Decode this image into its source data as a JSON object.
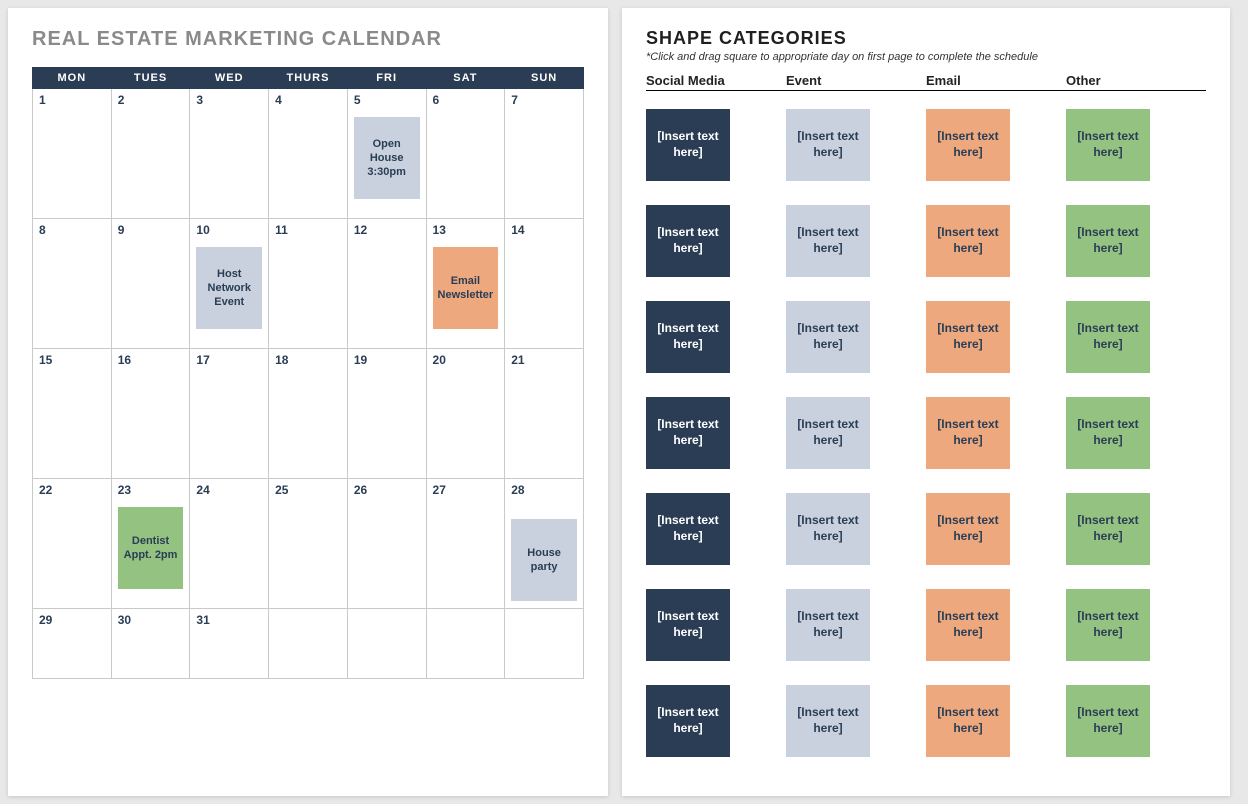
{
  "left": {
    "title": "REAL ESTATE MARKETING CALENDAR",
    "weekdays": [
      "MON",
      "TUES",
      "WED",
      "THURS",
      "FRI",
      "SAT",
      "SUN"
    ],
    "weeks": [
      [
        {
          "n": "1"
        },
        {
          "n": "2"
        },
        {
          "n": "3"
        },
        {
          "n": "4"
        },
        {
          "n": "5",
          "event": "Open House 3:30pm",
          "cls": "ev-blue"
        },
        {
          "n": "6"
        },
        {
          "n": "7"
        }
      ],
      [
        {
          "n": "8"
        },
        {
          "n": "9"
        },
        {
          "n": "10",
          "event": "Host Network Event",
          "cls": "ev-blue"
        },
        {
          "n": "11"
        },
        {
          "n": "12"
        },
        {
          "n": "13",
          "event": "Email Newsletter",
          "cls": "ev-orange"
        },
        {
          "n": "14"
        }
      ],
      [
        {
          "n": "15"
        },
        {
          "n": "16"
        },
        {
          "n": "17"
        },
        {
          "n": "18"
        },
        {
          "n": "19"
        },
        {
          "n": "20"
        },
        {
          "n": "21"
        }
      ],
      [
        {
          "n": "22"
        },
        {
          "n": "23",
          "event": "Dentist Appt. 2pm",
          "cls": "ev-green"
        },
        {
          "n": "24"
        },
        {
          "n": "25"
        },
        {
          "n": "26"
        },
        {
          "n": "27"
        },
        {
          "n": "28",
          "event": "House party",
          "cls": "ev-blue",
          "low": true
        }
      ],
      [
        {
          "n": "29"
        },
        {
          "n": "30"
        },
        {
          "n": "31"
        },
        {
          "n": ""
        },
        {
          "n": ""
        },
        {
          "n": ""
        },
        {
          "n": ""
        }
      ]
    ]
  },
  "right": {
    "title": "SHAPE CATEGORIES",
    "subtitle": "*Click and drag square to appropriate day on first page to complete the schedule",
    "columns": [
      {
        "label": "Social Media",
        "cls": "sh-navy"
      },
      {
        "label": "Event",
        "cls": "sh-blue"
      },
      {
        "label": "Email",
        "cls": "sh-orange"
      },
      {
        "label": "Other",
        "cls": "sh-green"
      }
    ],
    "placeholder": "[Insert text here]",
    "rows_per_column": 7
  }
}
